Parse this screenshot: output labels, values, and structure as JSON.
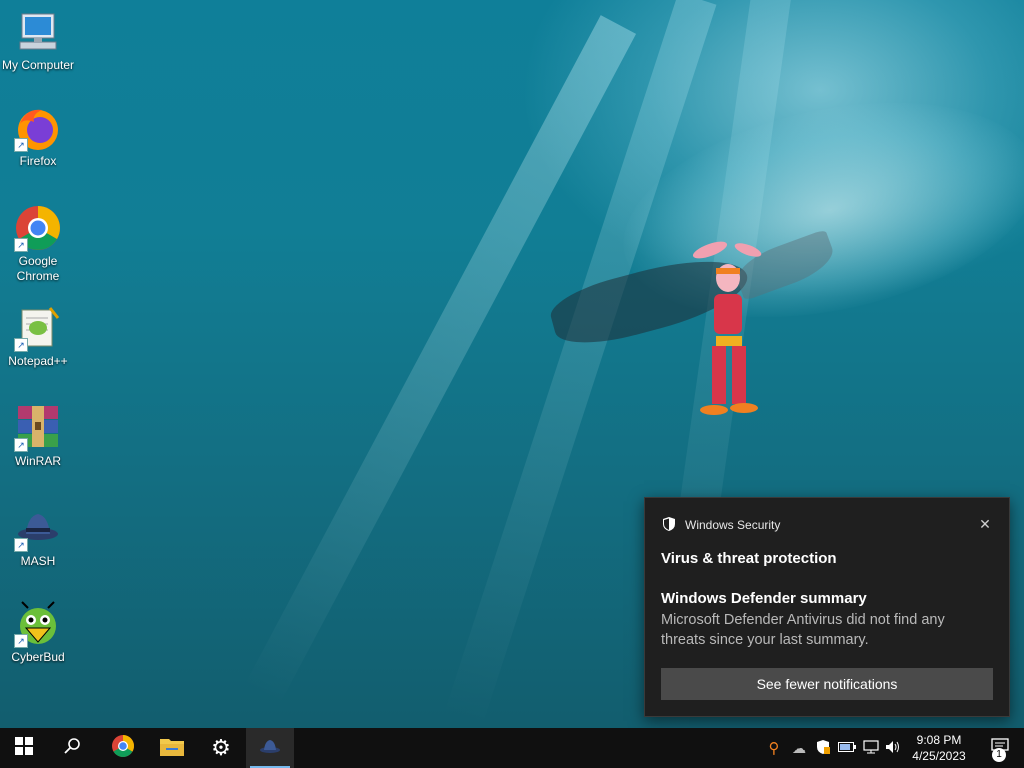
{
  "desktop": {
    "icons": [
      {
        "label": "My Computer"
      },
      {
        "label": "Firefox"
      },
      {
        "label": "Google Chrome"
      },
      {
        "label": "Notepad++"
      },
      {
        "label": "WinRAR"
      },
      {
        "label": "MASH"
      },
      {
        "label": "CyberBud"
      }
    ]
  },
  "notification": {
    "app_name": "Windows Security",
    "title": "Virus & threat protection",
    "subtitle": "Windows Defender summary",
    "body": "Microsoft Defender Antivirus did not find any threats since your last summary.",
    "button_label": "See fewer notifications",
    "close_glyph": "✕"
  },
  "taskbar": {
    "items": [
      "start",
      "search",
      "chrome",
      "file-explorer",
      "settings",
      "mash"
    ],
    "clock_time": "9:08 PM",
    "clock_date": "4/25/2023",
    "notification_count": "1"
  },
  "colors": {
    "accent": "#76b9ed",
    "toast_bg": "#1f1f1f",
    "taskbar_bg": "#101010"
  }
}
